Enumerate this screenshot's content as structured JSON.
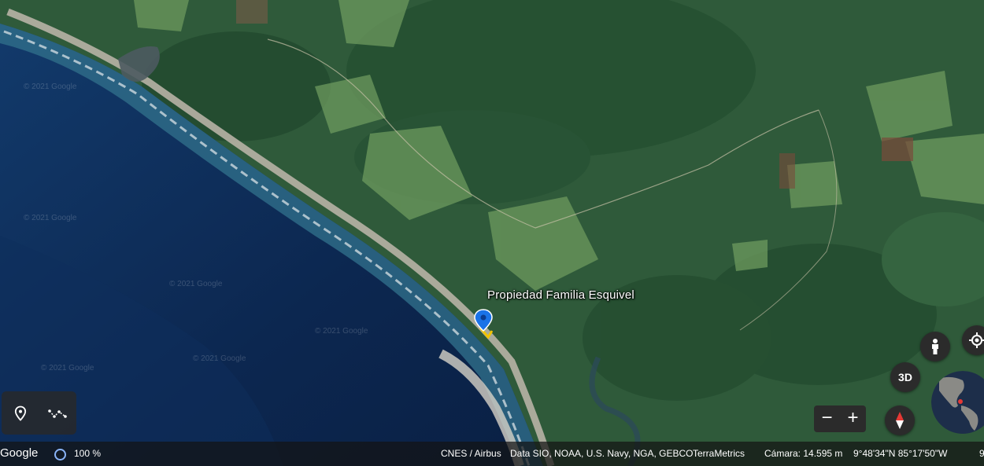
{
  "map": {
    "place_label": "Propiedad Familia Esquivel",
    "watermark": "© 2021 Google",
    "colors": {
      "sea_deep": "#0d2a52",
      "sea_shallow": "#2f6e8a",
      "land": "#2f5a3a",
      "field": "#6d9a5e",
      "beach": "#b8b2a6",
      "pin": "#1a73e8"
    }
  },
  "tools": {
    "placemark_icon": "pin-outline-icon",
    "path_icon": "path-icon"
  },
  "controls": {
    "street_view_icon": "pegman-icon",
    "locate_icon": "my-location-icon",
    "three_d": "3D",
    "zoom_out": "−",
    "zoom_in": "+",
    "compass_icon": "compass-icon",
    "globe_icon": "globe-icon"
  },
  "status": {
    "brand": "Google",
    "load_percent": "100 %",
    "attribution_1": "CNES / Airbus",
    "attribution_2": "Data SIO, NOAA, U.S. Navy, NGA, GEBCO",
    "attribution_3": "TerraMetrics",
    "camera": "Cámara: 14.595 m",
    "coordinates": "9°48'34\"N 85°17'50\"W",
    "cut_off": "9"
  }
}
